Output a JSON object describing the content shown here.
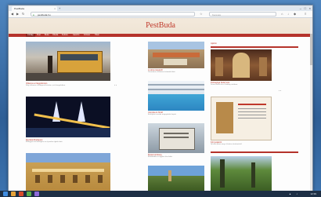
{
  "browser": {
    "tab_title": "PestBuda",
    "url": "pestbuda.hu",
    "search_placeholder": "Keresés",
    "window_controls": [
      "–",
      "□",
      "×"
    ]
  },
  "site": {
    "brand": "PestBuda",
    "nav": [
      "Címlap",
      "Pest",
      "Buda",
      "Óbuda",
      "Kultúra",
      "Gasztró",
      "Közélet",
      "Hírek"
    ],
    "sidebar_title": "Ajánló"
  },
  "articles_left": [
    {
      "caption": "Villamos a Nagykörúton",
      "text": "Régi villamos a budapesti körúton, esti hangulatban."
    },
    {
      "caption": "Éjszakai Budapest",
      "text": "A Megyeri híd kivilágítva az éjszakai égbolt alatt."
    },
    {
      "caption": "Régi homlokzatok",
      "text": ""
    }
  ],
  "articles_mid": [
    {
      "caption": "A város tetejéről",
      "text": "Panoráma a belváros háztetői fölött."
    },
    {
      "caption": "Uszoda és fürdő",
      "text": "A felújított uszoda megnyitotta kapuit."
    },
    {
      "caption": "Épített örökség",
      "text": "Emléktábla az egykori ház falán."
    },
    {
      "caption": "Város a hegyről",
      "text": ""
    }
  ],
  "articles_right": [
    {
      "caption": "Zsinagóga belső tere",
      "text": "Díszes belső tér a Dohány utcában."
    },
    {
      "caption": "Könyvajánló",
      "text": "Új kötet jelent meg a főváros történetéről."
    },
    {
      "caption": "Parkok",
      "text": ""
    }
  ],
  "taskbar": {
    "time": "12:39"
  },
  "colors": {
    "accent": "#b5332b",
    "brand": "#c0392b"
  }
}
